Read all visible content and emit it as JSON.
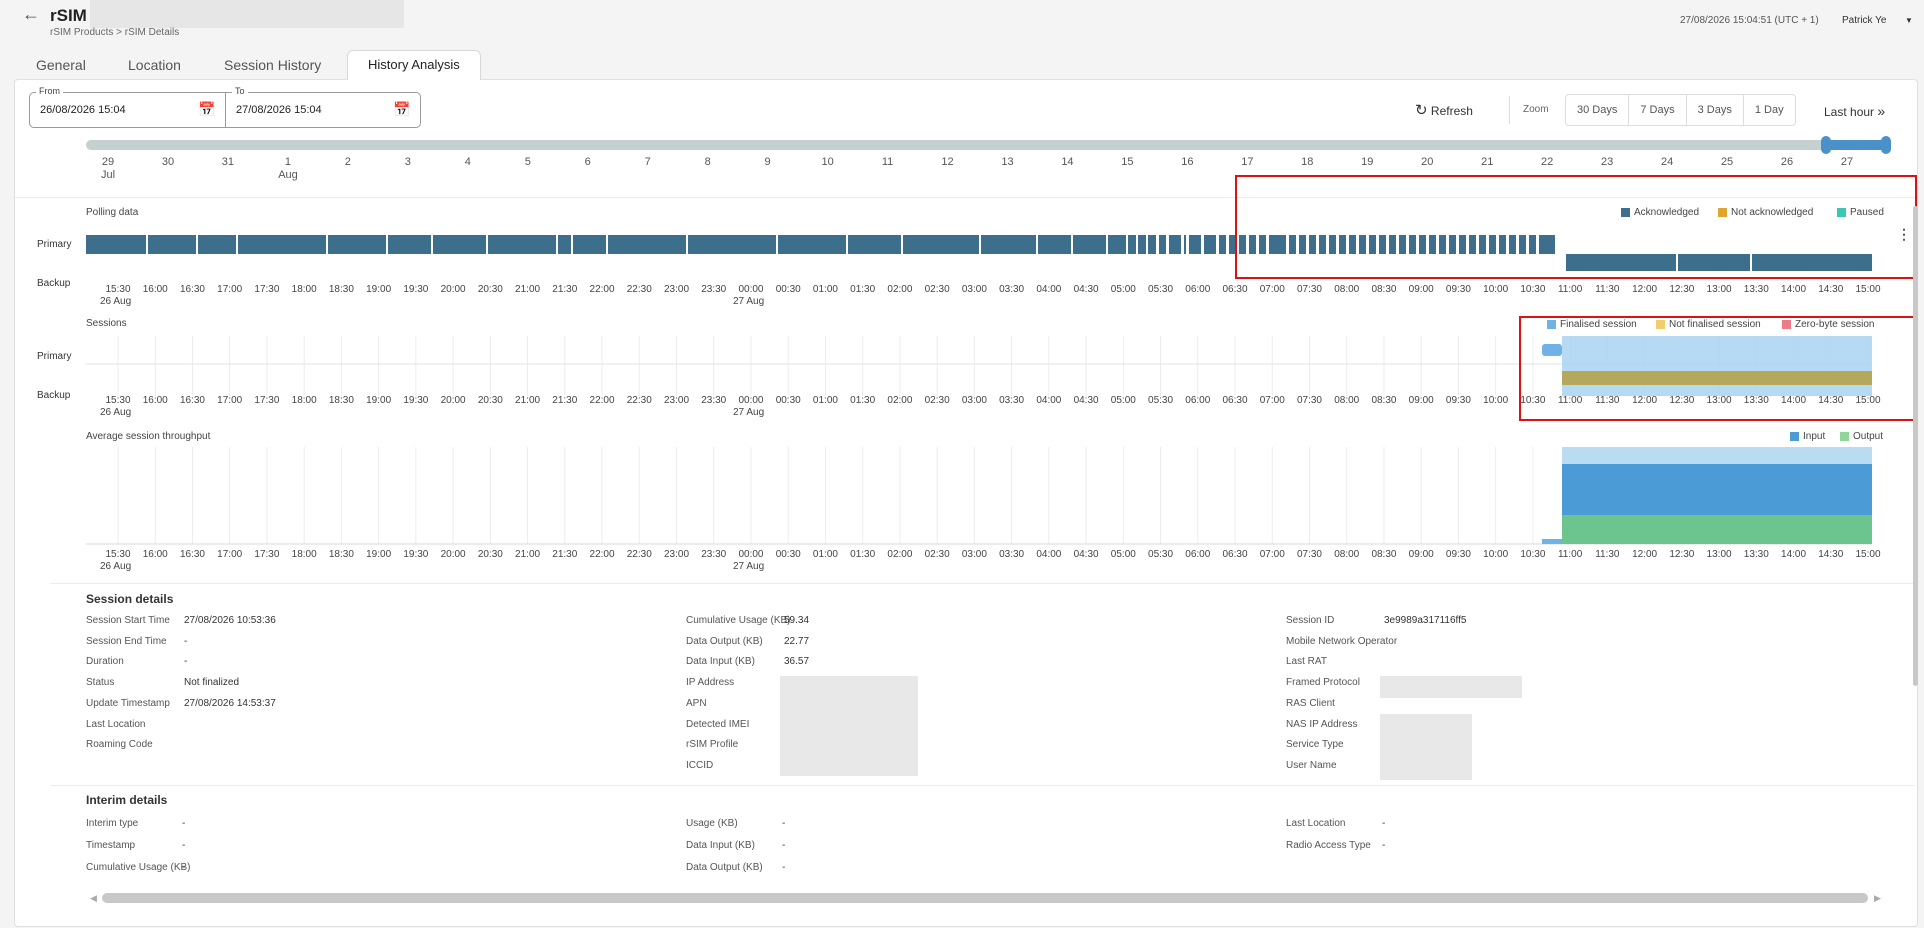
{
  "header": {
    "title": "rSIM",
    "breadcrumb": "rSIM Products > rSIM Details",
    "timestamp": "27/08/2026 15:04:51 (UTC + 1)",
    "user": "Patrick Ye"
  },
  "tabs": [
    "General",
    "Location",
    "Session History",
    "History Analysis"
  ],
  "active_tab": "History Analysis",
  "range": {
    "from_label": "From",
    "from_value": "26/08/2026 15:04",
    "to_label": "To",
    "to_value": "27/08/2026 15:04"
  },
  "controls": {
    "refresh": "Refresh",
    "zoom_label": "Zoom",
    "zoom_options": [
      "30 Days",
      "7 Days",
      "3 Days",
      "1 Day"
    ],
    "last_hour": "Last hour"
  },
  "timeline_days": [
    "29",
    "30",
    "31",
    "1",
    "2",
    "3",
    "4",
    "5",
    "6",
    "7",
    "8",
    "9",
    "10",
    "11",
    "12",
    "13",
    "14",
    "15",
    "16",
    "17",
    "18",
    "19",
    "20",
    "21",
    "22",
    "23",
    "24",
    "25",
    "26",
    "27"
  ],
  "timeline_months": {
    "jul": "Jul",
    "aug": "Aug"
  },
  "time_ticks": [
    "15:30",
    "16:00",
    "16:30",
    "17:00",
    "17:30",
    "18:00",
    "18:30",
    "19:00",
    "19:30",
    "20:00",
    "20:30",
    "21:00",
    "21:30",
    "22:00",
    "22:30",
    "23:00",
    "23:30",
    "00:00",
    "00:30",
    "01:00",
    "01:30",
    "02:00",
    "02:30",
    "03:00",
    "03:30",
    "04:00",
    "04:30",
    "05:00",
    "05:30",
    "06:00",
    "06:30",
    "07:00",
    "07:30",
    "08:00",
    "08:30",
    "09:00",
    "09:30",
    "10:00",
    "10:30",
    "11:00",
    "11:30",
    "12:00",
    "12:30",
    "13:00",
    "13:30",
    "14:00",
    "14:30",
    "15:00"
  ],
  "time_sub": {
    "first": "26 Aug",
    "mid": "27 Aug"
  },
  "polling": {
    "title": "Polling data",
    "primary": "Primary",
    "backup": "Backup",
    "legend": [
      {
        "label": "Acknowledged",
        "color": "#3d6f8c"
      },
      {
        "label": "Not acknowledged",
        "color": "#e0a52e"
      },
      {
        "label": "Paused",
        "color": "#3cc6b4"
      }
    ]
  },
  "sessions": {
    "title": "Sessions",
    "primary": "Primary",
    "backup": "Backup",
    "legend": [
      {
        "label": "Finalised session",
        "color": "#6fb3e6"
      },
      {
        "label": "Not finalised session",
        "color": "#f3cd6b"
      },
      {
        "label": "Zero-byte session",
        "color": "#ef7b86"
      }
    ]
  },
  "throughput": {
    "title": "Average session throughput",
    "legend": [
      {
        "label": "Input",
        "color": "#4b9bd6"
      },
      {
        "label": "Output",
        "color": "#8fd69a"
      }
    ]
  },
  "session_details": {
    "title": "Session details",
    "col1": [
      {
        "label": "Session Start Time",
        "value": "27/08/2026 10:53:36"
      },
      {
        "label": "Session End Time",
        "value": "-"
      },
      {
        "label": "Duration",
        "value": "-"
      },
      {
        "label": "Status",
        "value": "Not finalized"
      },
      {
        "label": "Update Timestamp",
        "value": "27/08/2026 14:53:37"
      },
      {
        "label": "Last Location",
        "value": ""
      },
      {
        "label": "Roaming Code",
        "value": ""
      }
    ],
    "col2": [
      {
        "label": "Cumulative Usage (KB)",
        "value": "59.34"
      },
      {
        "label": "Data Output (KB)",
        "value": "22.77"
      },
      {
        "label": "Data Input (KB)",
        "value": "36.57"
      },
      {
        "label": "IP Address",
        "value": ""
      },
      {
        "label": "APN",
        "value": ""
      },
      {
        "label": "Detected IMEI",
        "value": ""
      },
      {
        "label": "rSIM Profile",
        "value": ""
      },
      {
        "label": "ICCID",
        "value": ""
      }
    ],
    "col3": [
      {
        "label": "Session ID",
        "value": "3e9989a317116ff5"
      },
      {
        "label": "Mobile Network Operator",
        "value": ""
      },
      {
        "label": "Last RAT",
        "value": ""
      },
      {
        "label": "Framed Protocol",
        "value": ""
      },
      {
        "label": "RAS Client",
        "value": ""
      },
      {
        "label": "NAS IP Address",
        "value": ""
      },
      {
        "label": "Service Type",
        "value": ""
      },
      {
        "label": "User Name",
        "value": ""
      }
    ]
  },
  "interim_details": {
    "title": "Interim details",
    "col1": [
      {
        "label": "Interim type",
        "value": "-"
      },
      {
        "label": "Timestamp",
        "value": "-"
      },
      {
        "label": "Cumulative Usage (KB)",
        "value": "-"
      }
    ],
    "col2": [
      {
        "label": "Usage (KB)",
        "value": "-"
      },
      {
        "label": "Data Input (KB)",
        "value": "-"
      },
      {
        "label": "Data Output (KB)",
        "value": "-"
      }
    ],
    "col3": [
      {
        "label": "Last Location",
        "value": "-"
      },
      {
        "label": "Radio Access Type",
        "value": "-"
      }
    ]
  }
}
